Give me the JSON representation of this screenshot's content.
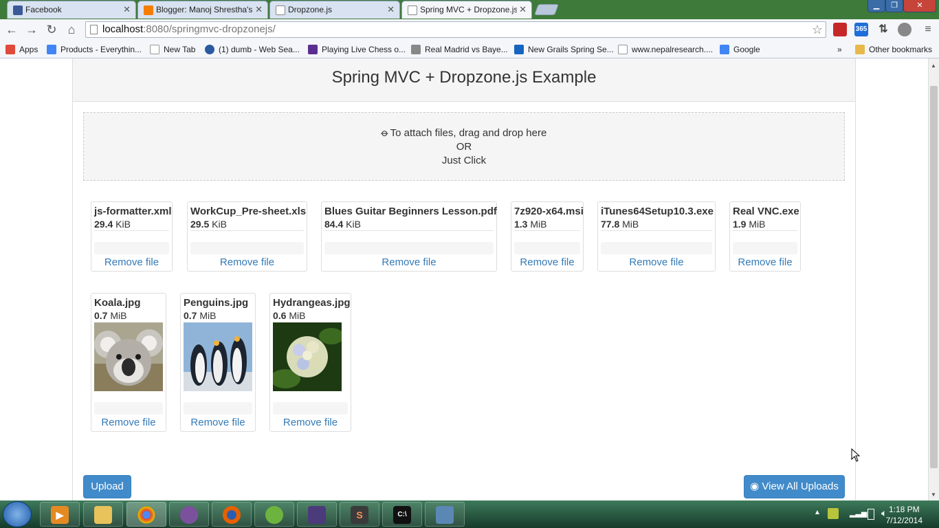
{
  "browser": {
    "tabs": [
      {
        "title": "Facebook",
        "icon": "facebook-icon",
        "color": "#3b5998"
      },
      {
        "title": "Blogger: Manoj Shrestha's",
        "icon": "blogger-icon",
        "color": "#f57d00"
      },
      {
        "title": "Dropzone.js",
        "icon": "page-icon",
        "color": "#ffffff"
      },
      {
        "title": "Spring MVC + Dropzone.js",
        "icon": "page-icon",
        "color": "#ffffff"
      }
    ],
    "close_glyph": "✕",
    "url_host": "localhost",
    "url_path": ":8080/springmvc-dropzonejs/",
    "bookmarks": [
      {
        "label": "Apps",
        "icon": "apps-grid-icon",
        "color": "#e04a3a"
      },
      {
        "label": "Products - Everythin...",
        "icon": "google-icon",
        "color": "#4285f4"
      },
      {
        "label": "New Tab",
        "icon": "page-icon",
        "color": "#ffffff"
      },
      {
        "label": "(1) dumb - Web Sea...",
        "icon": "web-search-icon",
        "color": "#2b5aa0"
      },
      {
        "label": "Playing Live Chess o...",
        "icon": "chess-icon",
        "color": "#5c2d91"
      },
      {
        "label": "Real Madrid vs Baye...",
        "icon": "football-icon",
        "color": "#888888"
      },
      {
        "label": "New Grails Spring Se...",
        "icon": "grails-icon",
        "color": "#1565c0"
      },
      {
        "label": "www.nepalresearch....",
        "icon": "page-icon",
        "color": "#ffffff"
      },
      {
        "label": "Google",
        "icon": "google-icon",
        "color": "#4285f4"
      }
    ],
    "bookmarks_overflow": "»",
    "other_bookmarks": "Other bookmarks"
  },
  "page": {
    "heading": "Spring MVC + Dropzone.js Example",
    "dropzone": {
      "line1": "To attach files, drag and drop here",
      "line2": "OR",
      "line3": "Just Click",
      "icon": "paperclip-icon"
    },
    "files_row1": [
      {
        "name": "js-formatter.xml",
        "size_value": "29.4",
        "size_unit": "KiB",
        "remove": "Remove file"
      },
      {
        "name": "WorkCup_Pre-sheet.xls",
        "size_value": "29.5",
        "size_unit": "KiB",
        "remove": "Remove file"
      },
      {
        "name": "Blues Guitar Beginners Lesson.pdf",
        "size_value": "84.4",
        "size_unit": "KiB",
        "remove": "Remove file"
      },
      {
        "name": "7z920-x64.msi",
        "size_value": "1.3",
        "size_unit": "MiB",
        "remove": "Remove file"
      },
      {
        "name": "iTunes64Setup10.3.exe",
        "size_value": "77.8",
        "size_unit": "MiB",
        "remove": "Remove file"
      },
      {
        "name": "Real VNC.exe",
        "size_value": "1.9",
        "size_unit": "MiB",
        "remove": "Remove file"
      }
    ],
    "files_row2": [
      {
        "name": "Koala.jpg",
        "size_value": "0.7",
        "size_unit": "MiB",
        "remove": "Remove file",
        "thumb": "koala-thumbnail"
      },
      {
        "name": "Penguins.jpg",
        "size_value": "0.7",
        "size_unit": "MiB",
        "remove": "Remove file",
        "thumb": "penguins-thumbnail"
      },
      {
        "name": "Hydrangeas.jpg",
        "size_value": "0.6",
        "size_unit": "MiB",
        "remove": "Remove file",
        "thumb": "hydrangeas-thumbnail"
      }
    ],
    "upload_button": "Upload",
    "view_all_button": "View All Uploads",
    "view_all_icon": "eye-icon",
    "accent_color": "#428bca",
    "link_color": "#337ab7"
  },
  "taskbar": {
    "apps": [
      "windows-media-icon",
      "explorer-icon",
      "chrome-icon",
      "viber-icon",
      "firefox-icon",
      "spring-icon",
      "javaee-ide-icon",
      "sublime-icon",
      "cmd-icon",
      "phone-icon"
    ],
    "time": "1:18 PM",
    "date": "7/12/2014"
  }
}
